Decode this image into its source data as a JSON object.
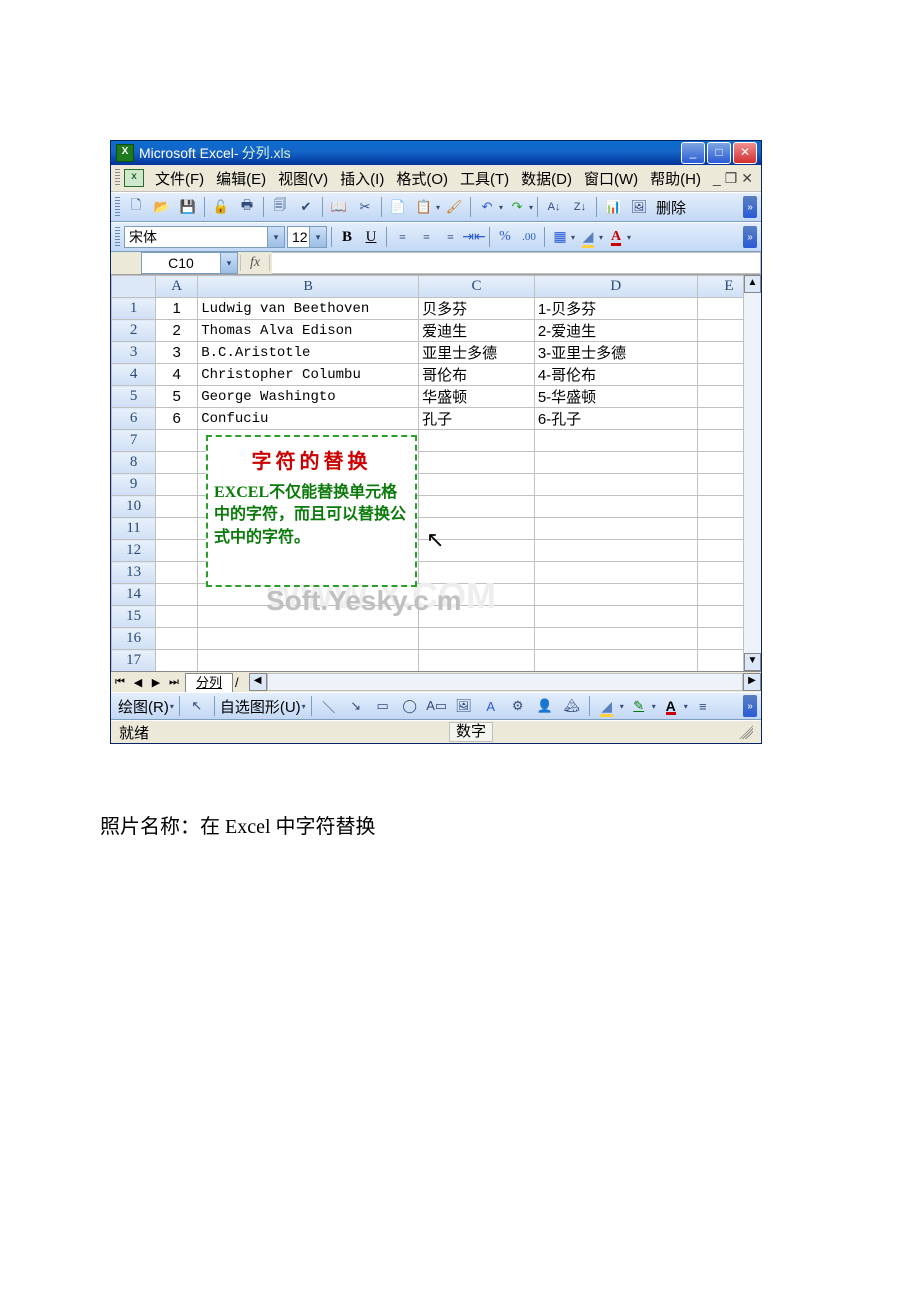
{
  "title": {
    "app": "Microsoft Excel",
    "sep": " - ",
    "doc": "分列.xls"
  },
  "menu": {
    "file": "文件(F)",
    "edit": "编辑(E)",
    "view": "视图(V)",
    "insert": "插入(I)",
    "format": "格式(O)",
    "tools": "工具(T)",
    "data": "数据(D)",
    "window": "窗口(W)",
    "help": "帮助(H)"
  },
  "toolbar": {
    "delete": "删除"
  },
  "format_bar": {
    "font": "宋体",
    "size": "12"
  },
  "namebox": "C10",
  "columns": [
    "A",
    "B",
    "C",
    "D",
    "E"
  ],
  "rows_shown": 18,
  "data_rows": [
    {
      "a": "1",
      "b": "Ludwig van Beethoven",
      "c": "贝多芬",
      "d": "1-贝多芬"
    },
    {
      "a": "2",
      "b": "Thomas Alva Edison",
      "c": "爱迪生",
      "d": "2-爱迪生"
    },
    {
      "a": "3",
      "b": "B.C.Aristotle",
      "c": "亚里士多德",
      "d": "3-亚里士多德"
    },
    {
      "a": "4",
      "b": "Christopher Columbu",
      "c": "哥伦布",
      "d": "4-哥伦布"
    },
    {
      "a": "5",
      "b": "George Washingto",
      "c": "华盛顿",
      "d": "5-华盛顿"
    },
    {
      "a": "6",
      "b": "Confuciu",
      "c": "孔子",
      "d": "6-孔子"
    }
  ],
  "callout": {
    "title": "字符的替换",
    "body": "EXCEL不仅能替换单元格中的字符，而且可以替换公式中的字符。"
  },
  "watermark1": "Soft.Yesky.c  m",
  "watermark_o": "0",
  "watermark2": "WWW             X.COM",
  "sheet_tab": "分列",
  "draw": {
    "label": "绘图(R)",
    "autos": "自选图形(U)"
  },
  "status": {
    "ready": "就绪",
    "mode": "数字"
  },
  "caption": "照片名称：在 Excel 中字符替换"
}
